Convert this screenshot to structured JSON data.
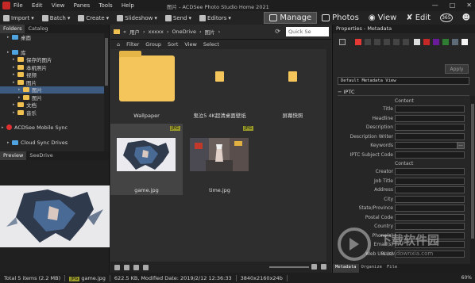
{
  "menu": [
    "File",
    "Edit",
    "View",
    "Panes",
    "Tools",
    "Help"
  ],
  "window_title": "图片 - ACDSee Photo Studio Home 2021",
  "toolbar": {
    "import": "Import",
    "batch": "Batch",
    "create": "Create",
    "slideshow": "Slideshow",
    "send": "Send",
    "editors": "Editors"
  },
  "modes": [
    "Manage",
    "Photos",
    "View",
    "Edit",
    "365"
  ],
  "left_tabs": [
    "Folders",
    "Catalog"
  ],
  "tree": [
    {
      "label": "桌面",
      "indent": 1,
      "icon": "blue"
    },
    {
      "label": "",
      "indent": 0,
      "icon": "none"
    },
    {
      "label": "库",
      "indent": 1,
      "icon": "blue"
    },
    {
      "label": "保存的图片",
      "indent": 2,
      "icon": "yellow"
    },
    {
      "label": "本机照片",
      "indent": 2,
      "icon": "yellow"
    },
    {
      "label": "视频",
      "indent": 2,
      "icon": "yellow"
    },
    {
      "label": "图片",
      "indent": 2,
      "icon": "yellow"
    },
    {
      "label": "图片",
      "indent": 3,
      "icon": "yellow",
      "selected": true
    },
    {
      "label": "图片",
      "indent": 3,
      "icon": "yellow"
    },
    {
      "label": "文档",
      "indent": 2,
      "icon": "yellow"
    },
    {
      "label": "音乐",
      "indent": 2,
      "icon": "yellow"
    },
    {
      "label": "",
      "indent": 0,
      "icon": "none"
    },
    {
      "label": "ACDSee Mobile Sync",
      "indent": 0,
      "icon": "red"
    },
    {
      "label": "",
      "indent": 0,
      "icon": "none"
    },
    {
      "label": "Cloud Sync Drives",
      "indent": 1,
      "icon": "blue"
    },
    {
      "label": "",
      "indent": 0,
      "icon": "none"
    }
  ],
  "preview_tabs": [
    "Preview",
    "SeeDrive"
  ],
  "address": {
    "crumbs": [
      "用户",
      "xxxxx",
      "OneDrive",
      "图片"
    ],
    "search_placeholder": "Quick Se"
  },
  "filterbar": [
    "Filter",
    "Group",
    "Sort",
    "View",
    "Select"
  ],
  "items": [
    {
      "name": "Wallpaper",
      "type": "folder-large",
      "selected": false
    },
    {
      "name": "鬼泣5 4K超清桌面壁纸",
      "type": "folder",
      "selected": false
    },
    {
      "name": "屏幕快照",
      "type": "folder",
      "selected": false
    },
    {
      "name": "game.jpg",
      "type": "image",
      "badge": "JPG",
      "selected": true
    },
    {
      "name": "time.jpg",
      "type": "image",
      "badge": "JPG",
      "selected": false
    }
  ],
  "props": {
    "header": "Properties - Metadata",
    "apply": "Apply",
    "view_select": "Default Metadata View",
    "section": "IPTC",
    "sub_content": "Content",
    "fields_content": [
      "Title",
      "Headline",
      "Description",
      "Description Writer",
      "Keywords",
      "IPTC Subject Code"
    ],
    "sub_creator": "Contact",
    "fields_creator": [
      "Creator",
      "Job Title",
      "Address",
      "City",
      "State/Province",
      "Postal Code",
      "Country",
      "Phone(s)",
      "Email(s)",
      "Web URL(s)"
    ],
    "keywords_button": "...",
    "tabs": [
      "Metadata",
      "Organize",
      "File"
    ]
  },
  "status": {
    "total": "Total 5 items  (2.2 MB)",
    "badge": "JPG",
    "filename": "game.jpg",
    "info": "622.5 KB, Modified Date: 2019/2/12 12:36:33",
    "dims": "3840x2160x24b",
    "zoom": "60%"
  },
  "watermark": {
    "text": "下载软件园",
    "url": "www.downxia.com"
  }
}
